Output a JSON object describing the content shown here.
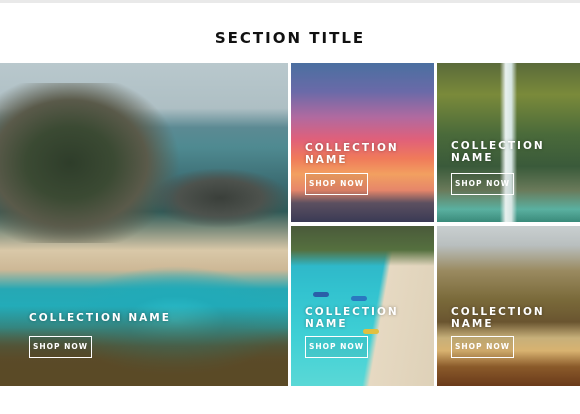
{
  "section": {
    "title": "SECTION TITLE"
  },
  "collections": [
    {
      "name": "COLLECTION NAME",
      "button": "SHOP NOW",
      "scene": "coastal-waterfall-cove"
    },
    {
      "name": "COLLECTION NAME",
      "button": "SHOP NOW",
      "scene": "pink-sunset-sky"
    },
    {
      "name": "COLLECTION NAME",
      "button": "SHOP NOW",
      "scene": "forest-waterfall"
    },
    {
      "name": "COLLECTION NAME",
      "button": "SHOP NOW",
      "scene": "aerial-beach-boats"
    },
    {
      "name": "COLLECTION NAME",
      "button": "SHOP NOW",
      "scene": "autumn-falls"
    }
  ]
}
